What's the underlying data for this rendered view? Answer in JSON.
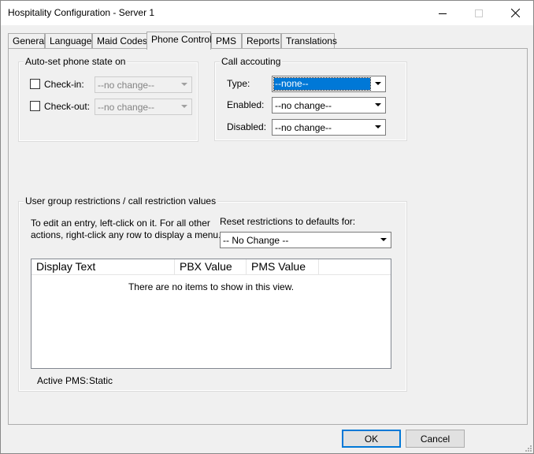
{
  "window": {
    "title": "Hospitality Configuration - Server 1",
    "minimize_glyph": "—",
    "maximize_glyph": "☐",
    "close_glyph": "✕"
  },
  "tabs": [
    {
      "label": "General"
    },
    {
      "label": "Language"
    },
    {
      "label": "Maid Codes"
    },
    {
      "label": "Phone Control",
      "active": true
    },
    {
      "label": "PMS"
    },
    {
      "label": "Reports"
    },
    {
      "label": "Translations"
    }
  ],
  "autoset": {
    "legend": "Auto-set phone state on",
    "checkin_label": "Check-in:",
    "checkin_checked": false,
    "checkin_value": "--no change--",
    "checkout_label": "Check-out:",
    "checkout_checked": false,
    "checkout_value": "--no change--"
  },
  "call_accounting": {
    "legend": "Call accouting",
    "type_label": "Type:",
    "type_value": "--none--",
    "enabled_label": "Enabled:",
    "enabled_value": "--no change--",
    "disabled_label": "Disabled:",
    "disabled_value": "--no change--"
  },
  "restrictions": {
    "legend": "User group restrictions / call restriction values",
    "help_line1": "To edit an entry, left-click on it.  For all other",
    "help_line2": "actions, right-click any row to display a menu.",
    "reset_label": "Reset restrictions to defaults for:",
    "reset_value": "-- No Change --",
    "columns": [
      "Display Text",
      "PBX Value",
      "PMS Value"
    ],
    "empty_text": "There are no items to show in this view.",
    "active_pms_label": "Active PMS:",
    "active_pms_value": "Static"
  },
  "buttons": {
    "ok": "OK",
    "cancel": "Cancel"
  }
}
